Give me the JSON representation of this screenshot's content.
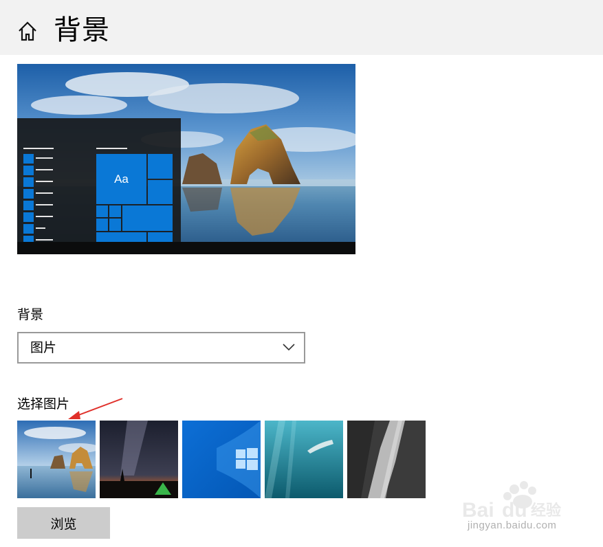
{
  "header": {
    "title": "背景",
    "home_icon": "home-icon"
  },
  "preview": {
    "tile_text": "Aa",
    "accent_color": "#0a78d6"
  },
  "background_section": {
    "label": "背景",
    "dropdown_value": "图片"
  },
  "choose_picture": {
    "label": "选择图片",
    "thumbnails": [
      "beach-rock-arch-thumbnail",
      "milky-way-tent-thumbnail",
      "windows-logo-thumbnail",
      "underwater-swimmer-thumbnail",
      "rock-cliff-thumbnail"
    ]
  },
  "browse_button": {
    "label": "浏览"
  },
  "watermark": {
    "url_text": "jingyan.baidu.com"
  }
}
